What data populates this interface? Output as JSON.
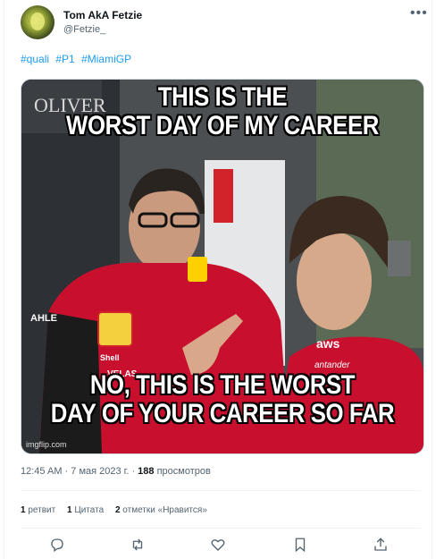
{
  "author": {
    "name": "Tom AkA Fetzie",
    "handle": "@Fetzie_"
  },
  "hashtags": [
    "#quali",
    "#P1",
    "#MiamiGP"
  ],
  "meme": {
    "top_caption": [
      "THIS IS THE",
      "WORST DAY OF MY CAREER"
    ],
    "bottom_caption": [
      "NO, THIS IS THE WORST",
      "DAY OF YOUR CAREER SO FAR"
    ],
    "watermark": "imgflip.com",
    "signage": {
      "oliver": "OLIVER",
      "shell": "Shell",
      "velas": "VELAS",
      "aws": "aws",
      "santander": "antander",
      "ahle": "AHLE"
    }
  },
  "meta": {
    "time": "12:45 AM",
    "date": "7 мая 2023 г.",
    "views_count": "188",
    "views_label": "просмотров"
  },
  "stats": {
    "retweets_count": "1",
    "retweets_label": "ретвит",
    "quotes_count": "1",
    "quotes_label": "Цитата",
    "likes_count": "2",
    "likes_label": "отметки «Нравится»"
  },
  "colors": {
    "accent": "#1d9bf0",
    "ferrari_red": "#c8102e",
    "text_secondary": "#536471"
  },
  "icons": [
    "more-icon",
    "reply-icon",
    "retweet-icon",
    "like-icon",
    "bookmark-icon",
    "share-icon"
  ]
}
